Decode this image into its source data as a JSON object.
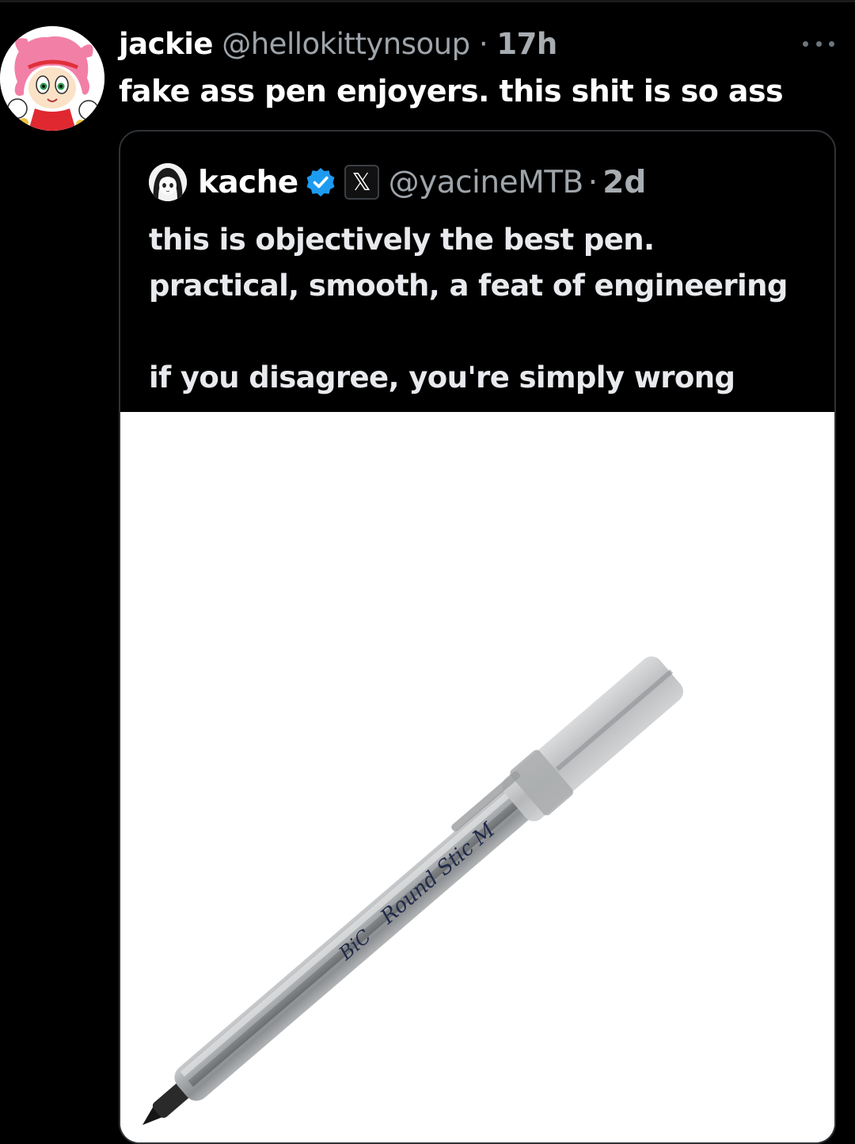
{
  "post": {
    "author": {
      "name": "jackie",
      "handle": "@hellokittynsoup"
    },
    "separator": "·",
    "time": "17h",
    "text": "fake ass pen enjoyers. this shit is so ass",
    "more_icon": "more-horizontal-icon"
  },
  "quote": {
    "author": {
      "name": "kache",
      "handle": "@yacineMTB",
      "verified": true,
      "badge": "𝕏"
    },
    "separator": "·",
    "time": "2d",
    "lines": [
      "this is objectively the best pen.",
      "practical, smooth, a feat of engineering",
      "",
      "if you disagree, you're simply wrong"
    ],
    "media": {
      "brand": "BiC",
      "model": "Round Stic M"
    }
  },
  "colors": {
    "background": "#000000",
    "text_primary": "#ffffff",
    "text_secondary": "#9ea4aa",
    "verified_blue": "#1d9bf0",
    "card_border": "#2f3336"
  }
}
